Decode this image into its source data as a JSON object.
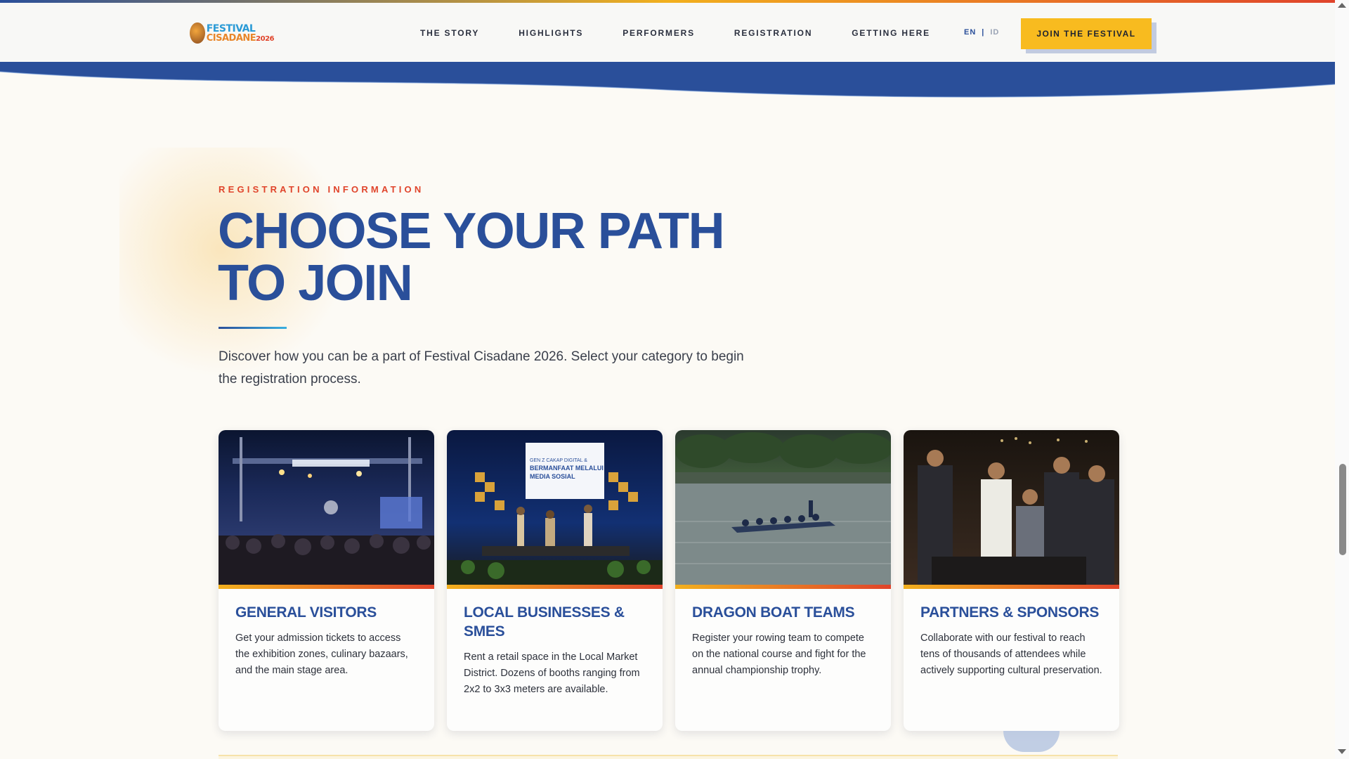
{
  "header": {
    "logo_line1": "FESTIVAL",
    "logo_line2": "CISADANE",
    "logo_year": "2026",
    "nav": [
      {
        "label": "THE STORY"
      },
      {
        "label": "HIGHLIGHTS"
      },
      {
        "label": "PERFORMERS"
      },
      {
        "label": "REGISTRATION"
      },
      {
        "label": "GETTING HERE"
      }
    ],
    "lang_en": "EN",
    "lang_sep": "|",
    "lang_id": "ID",
    "cta": "JOIN THE FESTIVAL"
  },
  "section": {
    "eyebrow": "REGISTRATION INFORMATION",
    "title": "CHOOSE YOUR PATH TO JOIN",
    "intro": "Discover how you can be a part of Festival Cisadane 2026. Select your category to begin the registration process."
  },
  "cards": [
    {
      "title": "GENERAL VISITORS",
      "text": "Get your admission tickets to access the exhibition zones, culinary bazaars, and the main stage area."
    },
    {
      "title": "LOCAL BUSINESSES & SMES",
      "text": "Rent a retail space in the Local Market District. Dozens of booths ranging from 2x2 to 3x3 meters are available."
    },
    {
      "title": "DRAGON BOAT TEAMS",
      "text": "Register your rowing team to compete on the national course and fight for the annual championship trophy."
    },
    {
      "title": "PARTNERS & SPONSORS",
      "text": "Collaborate with our festival to reach tens of thousands of attendees while actively supporting cultural preservation."
    }
  ],
  "photo_banner": {
    "line1": "GEN Z CAKAP DIGITAL &",
    "line2": "BERMANFAAT MELALUI",
    "line3": "MEDIA SOSIAL"
  },
  "colors": {
    "brand_blue": "#2a4f9a",
    "accent_yellow": "#f8bb1f",
    "accent_red": "#e0442b"
  }
}
